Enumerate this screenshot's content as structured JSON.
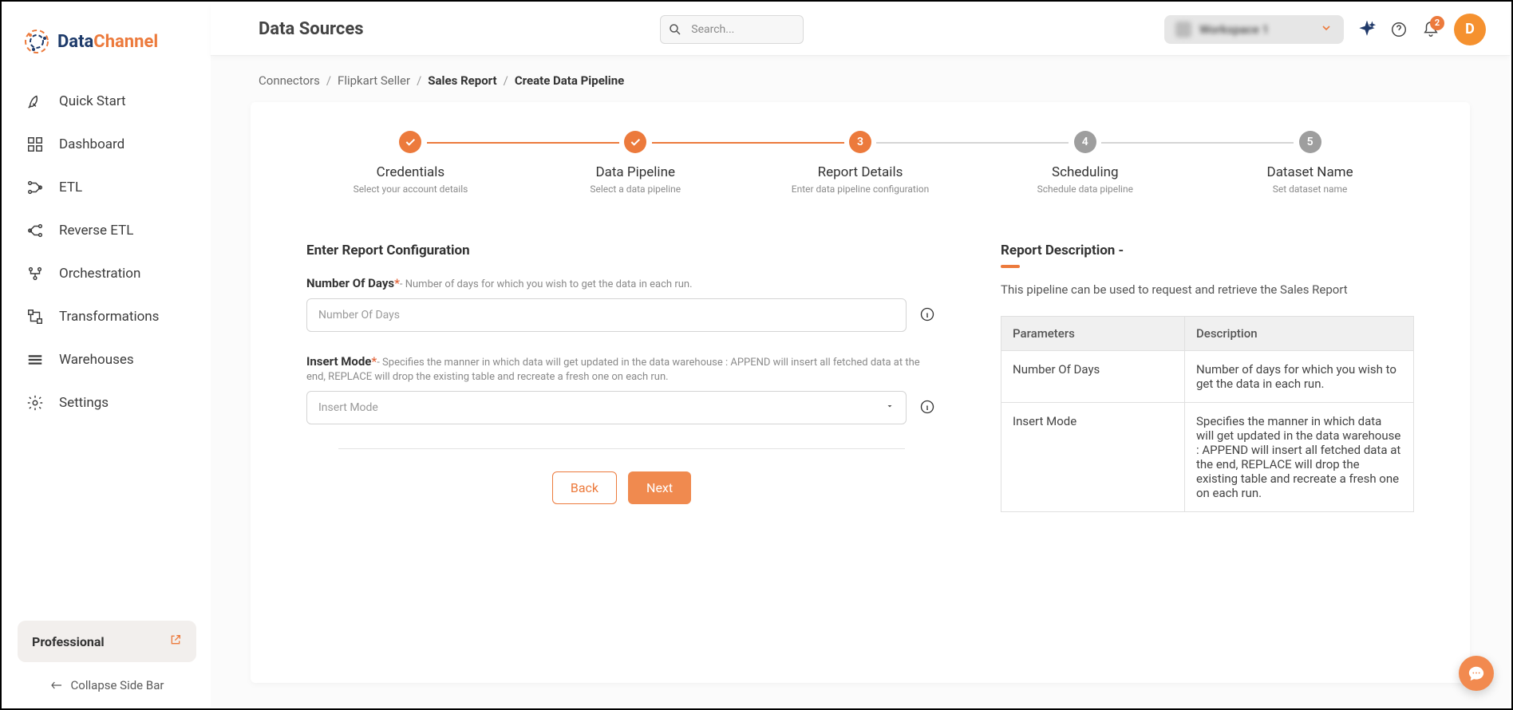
{
  "brand": {
    "part1": "Data",
    "part2": "Channel"
  },
  "sidebar": {
    "items": [
      {
        "label": "Quick Start"
      },
      {
        "label": "Dashboard"
      },
      {
        "label": "ETL"
      },
      {
        "label": "Reverse ETL"
      },
      {
        "label": "Orchestration"
      },
      {
        "label": "Transformations"
      },
      {
        "label": "Warehouses"
      },
      {
        "label": "Settings"
      }
    ],
    "plan": "Professional",
    "collapse": "Collapse Side Bar"
  },
  "topbar": {
    "title": "Data Sources",
    "search_placeholder": "Search...",
    "workspace": "Workspace 1",
    "notif_count": "2",
    "avatar_letter": "D"
  },
  "breadcrumbs": [
    {
      "label": "Connectors",
      "strong": false
    },
    {
      "label": "Flipkart Seller",
      "strong": false
    },
    {
      "label": "Sales Report",
      "strong": true
    },
    {
      "label": "Create Data Pipeline",
      "strong": true
    }
  ],
  "stepper": [
    {
      "title": "Credentials",
      "sub": "Select your account details",
      "state": "done"
    },
    {
      "title": "Data Pipeline",
      "sub": "Select a data pipeline",
      "state": "done"
    },
    {
      "title": "Report Details",
      "sub": "Enter data pipeline configuration",
      "state": "active",
      "num": "3"
    },
    {
      "title": "Scheduling",
      "sub": "Schedule data pipeline",
      "state": "upcoming",
      "num": "4"
    },
    {
      "title": "Dataset Name",
      "sub": "Set dataset name",
      "state": "upcoming",
      "num": "5"
    }
  ],
  "form": {
    "section_title": "Enter Report Configuration",
    "fields": {
      "days": {
        "label": "Number Of Days",
        "hint": "- Number of days for which you wish to get the data in each run.",
        "placeholder": "Number Of Days"
      },
      "insert": {
        "label": "Insert Mode",
        "hint": "- Specifies the manner in which data will get updated in the data warehouse : APPEND will insert all fetched data at the end, REPLACE will drop the existing table and recreate a fresh one on each run.",
        "placeholder": "Insert Mode"
      }
    },
    "back": "Back",
    "next": "Next"
  },
  "desc": {
    "title": "Report Description -",
    "text": "This pipeline can be used to request and retrieve the Sales Report",
    "th1": "Parameters",
    "th2": "Description",
    "rows": [
      {
        "p": "Number Of Days",
        "d": "Number of days for which you wish to get the data in each run."
      },
      {
        "p": "Insert Mode",
        "d": "Specifies the manner in which data will get updated in the data warehouse : APPEND will insert all fetched data at the end, REPLACE will drop the existing table and recreate a fresh one on each run."
      }
    ]
  }
}
